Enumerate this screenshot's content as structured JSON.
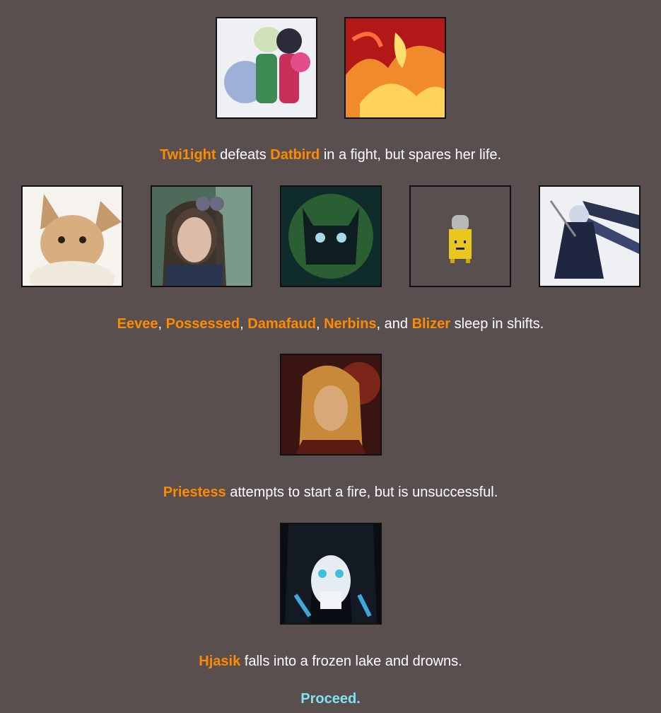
{
  "event1": {
    "name_a": "Twi1ight",
    "text_a": " defeats ",
    "name_b": "Datbird",
    "text_b": " in a fight, but spares her life."
  },
  "event2": {
    "names": [
      "Eevee",
      "Possessed",
      "Damafaud",
      "Nerbins",
      "Blizer"
    ],
    "sep": ", ",
    "and": ", and ",
    "tail": " sleep in shifts."
  },
  "event3": {
    "name": "Priestess",
    "tail": " attempts to start a fire, but is unsuccessful."
  },
  "event4": {
    "name": "Hjasik",
    "tail": " falls into a frozen lake and drowns."
  },
  "proceed_label": "Proceed.",
  "colors": {
    "background": "#5a4f4f",
    "name": "#ff8a00",
    "text": "#ffffff",
    "link": "#7fe3f5"
  }
}
